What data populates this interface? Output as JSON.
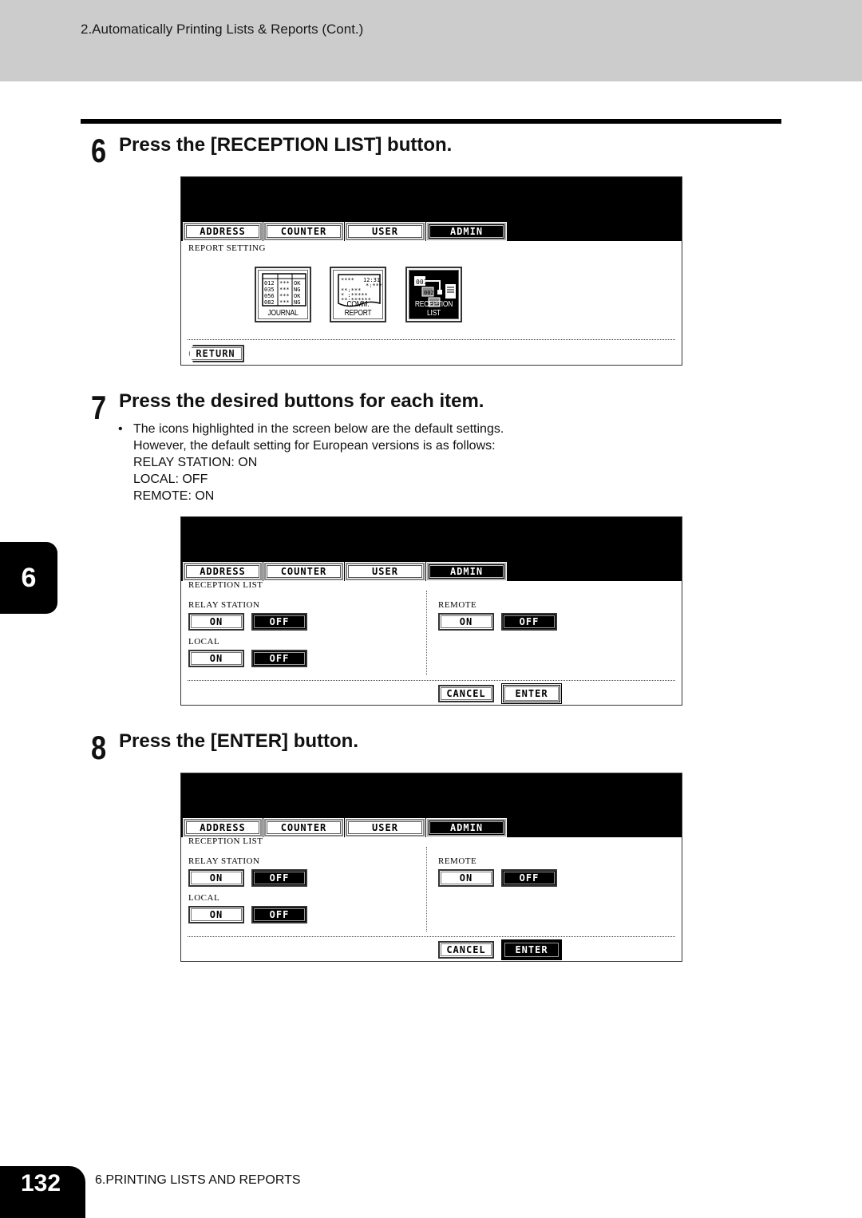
{
  "header": {
    "breadcrumb": "2.Automatically Printing Lists & Reports (Cont.)"
  },
  "steps": [
    {
      "number": "6",
      "title": "Press the [RECEPTION LIST] button."
    },
    {
      "number": "7",
      "title": "Press the desired buttons for each item."
    },
    {
      "number": "8",
      "title": "Press the [ENTER] button."
    }
  ],
  "notes": {
    "bullet": "•",
    "lines": [
      "The icons highlighted in the screen below are the default settings.",
      "However, the default setting for European versions is as follows:",
      "RELAY STATION: ON",
      "LOCAL: OFF",
      "REMOTE: ON"
    ]
  },
  "tabs": [
    "ADDRESS",
    "COUNTER",
    "USER",
    "ADMIN"
  ],
  "active_tab": "ADMIN",
  "panel1": {
    "title": "REPORT SETTING",
    "icons": [
      {
        "name": "journal",
        "label": "JOURNAL",
        "selected": false
      },
      {
        "name": "comm-report",
        "label": "COMM. REPORT",
        "selected": false
      },
      {
        "name": "reception-list",
        "label": "RECEPTION LIST",
        "selected": true
      }
    ],
    "journal_rows": [
      [
        "012",
        "***",
        "OK"
      ],
      [
        "035",
        "***",
        "NG"
      ],
      [
        "056",
        "***",
        "OK"
      ],
      [
        "082",
        "***",
        "NG"
      ]
    ],
    "comm_time": "12:31",
    "reception_codes": [
      "001",
      "002",
      "003"
    ],
    "return_label": "RETURN"
  },
  "panel2": {
    "title": "RECEPTION LIST",
    "relay_station": {
      "label": "RELAY STATION",
      "on": "ON",
      "off": "OFF",
      "value": "OFF"
    },
    "local": {
      "label": "LOCAL",
      "on": "ON",
      "off": "OFF",
      "value": "OFF"
    },
    "remote": {
      "label": "REMOTE",
      "on": "ON",
      "off": "OFF",
      "value": "OFF"
    },
    "cancel_label": "CANCEL",
    "enter_label": "ENTER",
    "enter_pressed": false
  },
  "panel3": {
    "title": "RECEPTION LIST",
    "relay_station": {
      "label": "RELAY STATION",
      "on": "ON",
      "off": "OFF",
      "value": "OFF"
    },
    "local": {
      "label": "LOCAL",
      "on": "ON",
      "off": "OFF",
      "value": "OFF"
    },
    "remote": {
      "label": "REMOTE",
      "on": "ON",
      "off": "OFF",
      "value": "OFF"
    },
    "cancel_label": "CANCEL",
    "enter_label": "ENTER",
    "enter_pressed": true
  },
  "chapter_tab": "6",
  "footer": {
    "page_number": "132",
    "section_title": "6.PRINTING LISTS AND REPORTS"
  }
}
